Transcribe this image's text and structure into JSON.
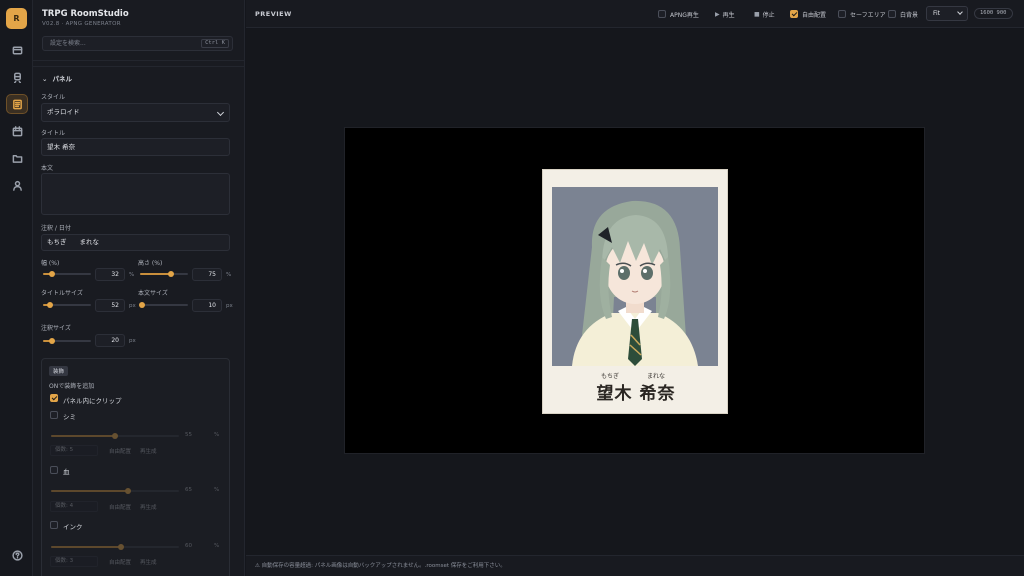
{
  "app": {
    "logo_letter": "R",
    "title": "TRPG RoomStudio",
    "version": "V02.8 · APNG GENERATOR"
  },
  "search": {
    "placeholder": "設定を検索...",
    "shortcut": "Ctrl K"
  },
  "panel": {
    "section_title": "パネル",
    "style_label": "スタイル",
    "style_value": "ポラロイド",
    "title_label": "タイトル",
    "title_value": "望木 希奈",
    "body_label": "本文",
    "body_value": "",
    "note_label": "注釈 / 日付",
    "note_value": "もちぎ　　まれな",
    "width_label": "幅 (%)",
    "width_value": "32",
    "width_fraction": 0.18,
    "height_label": "高さ (%)",
    "height_value": "75",
    "height_fraction": 0.65,
    "title_size_label": "タイトルサイズ",
    "title_size_value": "52",
    "title_size_fraction": 0.15,
    "body_size_label": "本文サイズ",
    "body_size_value": "10",
    "body_size_fraction": 0.05,
    "note_size_label": "注釈サイズ",
    "note_size_value": "20",
    "note_size_fraction": 0.18,
    "unit_percent": "%",
    "unit_px": "px"
  },
  "decoration": {
    "badge": "装飾",
    "hint": "ONで装飾を追加",
    "clip_label": "パネル内にクリップ",
    "clip_checked": true,
    "items": [
      {
        "label": "シミ",
        "value": "55",
        "unit": "%",
        "count": "個数: 5",
        "free": "自由配置",
        "regen": "再生成",
        "checked": false,
        "level": 0.5
      },
      {
        "label": "血",
        "value": "65",
        "unit": "%",
        "count": "個数: 4",
        "free": "自由配置",
        "regen": "再生成",
        "checked": false,
        "level": 0.6
      },
      {
        "label": "インク",
        "value": "60",
        "unit": "%",
        "count": "個数: 3",
        "free": "自由配置",
        "regen": "再生成",
        "checked": false,
        "level": 0.55
      }
    ]
  },
  "toolbar": {
    "preview_label": "PREVIEW",
    "apng_play": "APNG再生",
    "play": "再生",
    "stop": "停止",
    "free_layout": "自由配置",
    "safe_area": "セーフエリア",
    "white_bg": "白背景",
    "fit": "Fit",
    "resolution": "1600 900"
  },
  "preview": {
    "ruby_left": "もちぎ",
    "ruby_right": "まれな",
    "name": "望木 希奈"
  },
  "status": "⚠ 自動保存の容量超過: パネル画像は自動バックアップされません。.roomset 保存をご利用下さい。",
  "colors": {
    "accent": "#e3a548",
    "canvas": "#000000",
    "paper": "#f3efe6"
  },
  "icons": [
    "logo",
    "card-icon",
    "train-icon",
    "document-icon",
    "calendar-icon",
    "folder-icon",
    "user-icon",
    "help-icon"
  ]
}
